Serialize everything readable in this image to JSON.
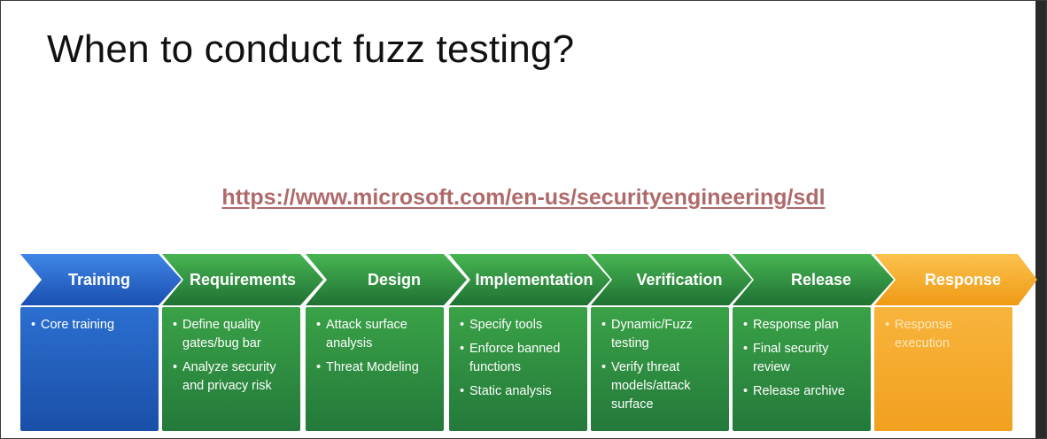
{
  "slide": {
    "title": "When to conduct fuzz testing?",
    "link": "https://www.microsoft.com/en-us/securityengineering/sdl"
  },
  "colors": {
    "training": "#1f5fbf",
    "green_phase": "#2f8f3f",
    "response": "#f5a623",
    "link": "#b06a6a"
  },
  "phases": [
    {
      "name": "Training",
      "items": [
        "Core training"
      ]
    },
    {
      "name": "Requirements",
      "items": [
        "Define quality gates/bug bar",
        "Analyze security and privacy risk"
      ]
    },
    {
      "name": "Design",
      "items": [
        "Attack surface analysis",
        "Threat Modeling"
      ]
    },
    {
      "name": "Implementation",
      "items": [
        "Specify tools",
        "Enforce banned functions",
        "Static analysis"
      ]
    },
    {
      "name": "Verification",
      "items": [
        "Dynamic/Fuzz testing",
        "Verify threat models/attack surface"
      ]
    },
    {
      "name": "Release",
      "items": [
        "Response plan",
        "Final security review",
        "Release archive"
      ]
    },
    {
      "name": "Response",
      "items": [
        "Response execution"
      ]
    }
  ]
}
